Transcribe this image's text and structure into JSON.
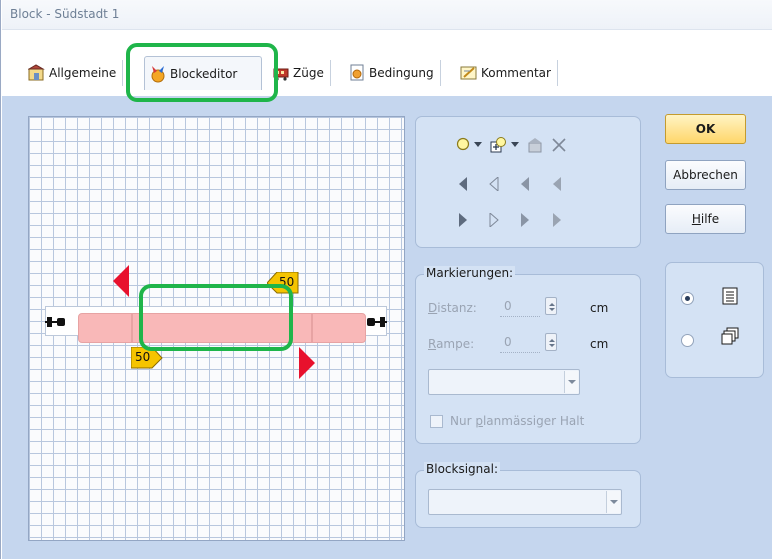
{
  "window": {
    "title": "Block - Südstadt 1"
  },
  "tabs": [
    {
      "label": "Allgemeine",
      "icon": "general-settings-icon"
    },
    {
      "label": "Blockeditor",
      "icon": "block-editor-icon",
      "active": true
    },
    {
      "label": "Züge",
      "icon": "trains-icon"
    },
    {
      "label": "Bedingung",
      "icon": "condition-icon"
    },
    {
      "label": "Kommentar",
      "icon": "comment-icon"
    }
  ],
  "editor": {
    "speed_markers": [
      "50",
      "50"
    ]
  },
  "toolbar": {
    "icons": [
      "marker-add-icon",
      "shape-add-icon",
      "properties-icon",
      "delete-icon"
    ],
    "arrow_rows": [
      "left-arrows",
      "right-arrows"
    ]
  },
  "markierungen": {
    "label": "Markierungen:",
    "distanz_label": "Distanz:",
    "distanz_value": "0",
    "distanz_unit": "cm",
    "rampe_label": "Rampe:",
    "rampe_value": "0",
    "rampe_unit": "cm",
    "select_value": "",
    "checkbox_label": "Nur planmässiger Halt",
    "checkbox_checked": false
  },
  "blocksignal": {
    "label": "Blocksignal:",
    "select_value": ""
  },
  "buttons": {
    "ok": "OK",
    "cancel": "Abbrechen",
    "help": "Hilfe"
  },
  "view_options": [
    {
      "icon": "list-view-icon",
      "checked": true
    },
    {
      "icon": "windows-view-icon",
      "checked": false
    }
  ],
  "colors": {
    "highlight": "#1fb54a",
    "block_segment": "#f9b8b8",
    "signal_red": "#e8112d",
    "marker_yellow": "#f5c400",
    "ok_button": "#ffd66a"
  }
}
